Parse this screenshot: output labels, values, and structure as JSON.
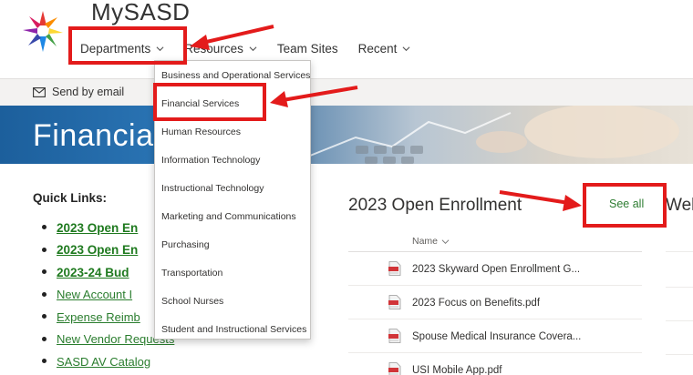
{
  "site": {
    "title": "MySASD"
  },
  "nav": [
    {
      "label": "Departments"
    },
    {
      "label": "Resources"
    },
    {
      "label": "Team Sites"
    },
    {
      "label": "Recent"
    }
  ],
  "command_bar": {
    "send_email": "Send by email"
  },
  "hero": {
    "title": "Financial"
  },
  "dropdown": {
    "items": [
      "Business and Operational Services",
      "Financial Services",
      "Human Resources",
      "Information Technology",
      "Instructional Technology",
      "Marketing and Communications",
      "Purchasing",
      "Transportation",
      "School Nurses",
      "Student and Instructional Services"
    ]
  },
  "quick_links": {
    "title": "Quick Links:",
    "items": [
      {
        "label": "2023 Open En",
        "bold": true
      },
      {
        "label": "2023 Open En",
        "bold": true
      },
      {
        "label": "2023-24 Bud",
        "bold": true
      },
      {
        "label": "New Account I",
        "bold": false
      },
      {
        "label": "Expense Reimb",
        "bold": false
      },
      {
        "label": "New Vendor Requests",
        "bold": false
      },
      {
        "label": "SASD AV Catalog",
        "bold": false
      }
    ]
  },
  "documents": {
    "title": "2023 Open Enrollment",
    "see_all": "See all",
    "column_name": "Name",
    "files": [
      "2023 Skyward Open Enrollment G...",
      "2023 Focus on Benefits.pdf",
      "Spouse Medical Insurance Covera...",
      "USI Mobile App.pdf"
    ]
  },
  "next_section": {
    "title_fragment": "Wel"
  },
  "colors": {
    "accent_link": "#2a7d2e",
    "annotation": "#e31b1b",
    "hero_blue": "#1c5f9c"
  }
}
